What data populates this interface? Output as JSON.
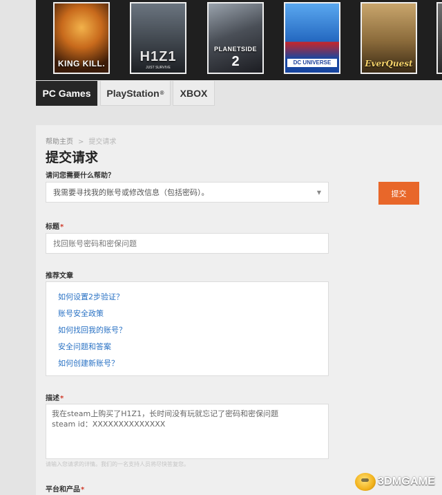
{
  "games": [
    {
      "name": "H1Z1 King of the Kill",
      "cover_text": "KING KILL."
    },
    {
      "name": "H1Z1 Just Survive",
      "cover_text": "H1Z1",
      "cover_sub": "JUST SURVIVE"
    },
    {
      "name": "PlanetSide 2",
      "cover_text": "PLANETSIDE",
      "cover_num": "2"
    },
    {
      "name": "DC Universe Online",
      "cover_text": "DC UNIVERSE"
    },
    {
      "name": "EverQuest",
      "cover_text": "EverQuest"
    }
  ],
  "tabs": [
    {
      "label": "PC Games",
      "active": true
    },
    {
      "label": "PlayStation",
      "mark": "®"
    },
    {
      "label": "XBOX"
    }
  ],
  "breadcrumb": {
    "home": "帮助主页",
    "separator": ">",
    "current": "提交请求"
  },
  "page_title": "提交请求",
  "form": {
    "help_label": "请问您需要什么帮助？",
    "help_value": "我需要寻找我的账号或修改信息（包括密码）。",
    "subject_label": "标题",
    "required_mark": "*",
    "subject_value": "找回账号密码和密保问题",
    "articles_label": "推荐文章",
    "articles": [
      "如何设置2步验证？",
      "账号安全政策",
      "如何找回我的账号？",
      "安全问题和答案",
      "如何创建新账号？"
    ],
    "description_label": "描述",
    "description_lines": [
      "我在steam上购买了H1Z1，长时间没有玩就忘记了密码和密保问题",
      "steam id：XXXXXXXXXXXXXX"
    ],
    "description_help": "请输入您请求的详情。我们的一名支持人员将尽快答复您。",
    "platform_label": "平台和产品",
    "submit_label": "提交"
  },
  "watermark": "3DMGAME",
  "colors": {
    "accent": "#e8672a",
    "link": "#2a72c4",
    "required": "#d03a2a",
    "banner_bg": "#1f1f1f"
  }
}
